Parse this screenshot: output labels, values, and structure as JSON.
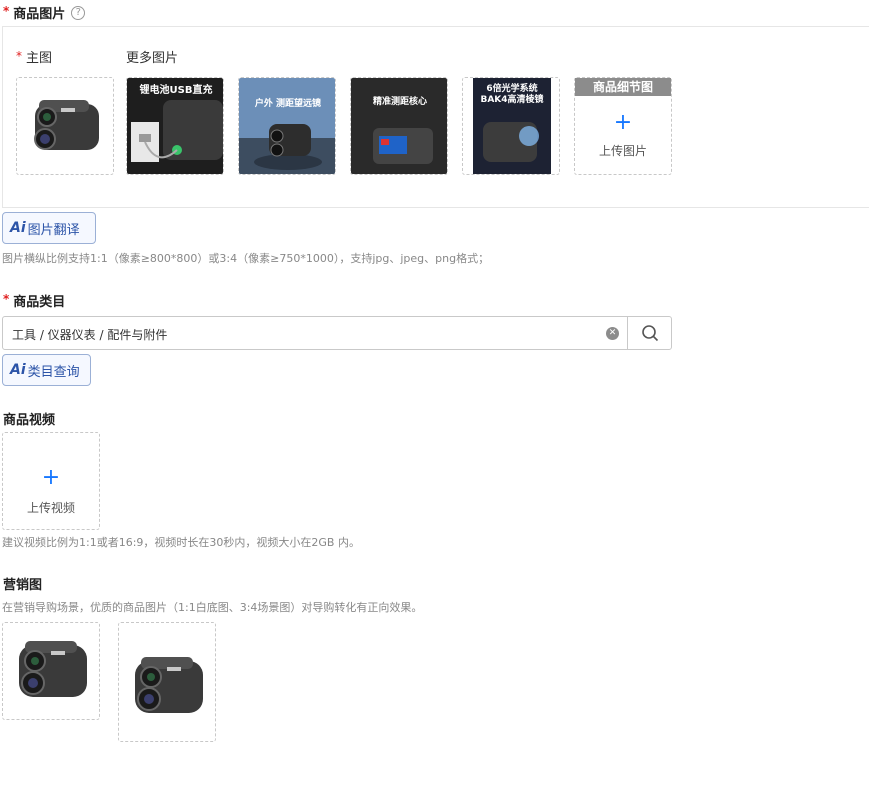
{
  "product_images": {
    "title": "商品图片",
    "main_label": "主图",
    "more_label": "更多图片",
    "thumbs": [
      {
        "caption": ""
      },
      {
        "caption": "锂电池USB直充"
      },
      {
        "caption": "户外 测距望远镜"
      },
      {
        "caption": "精准测距核心"
      },
      {
        "caption": "6倍光学系统 BAK4高清棱镜"
      }
    ],
    "detail_header": "商品细节图",
    "upload_label": "上传图片"
  },
  "ai_translate": {
    "label": "图片翻译",
    "ai": "Ai"
  },
  "image_hint": "图片横纵比例支持1:1（像素≥800*800）或3:4（像素≥750*1000），支持jpg、jpeg、png格式；",
  "category": {
    "title": "商品类目",
    "value": "工具 / 仪器仪表 / 配件与附件",
    "ai_query": {
      "label": "类目查询",
      "ai": "Ai"
    }
  },
  "video": {
    "title": "商品视频",
    "upload_label": "上传视频",
    "hint": "建议视频比例为1:1或者16:9，视频时长在30秒内，视频大小在2GB 内。"
  },
  "marketing": {
    "title": "营销图",
    "hint": "在营销导购场景，优质的商品图片（1:1白底图、3:4场景图）对导购转化有正向效果。"
  },
  "colors": {
    "accent": "#1677ff",
    "required": "#e02020",
    "ai": "#2c54a8"
  }
}
